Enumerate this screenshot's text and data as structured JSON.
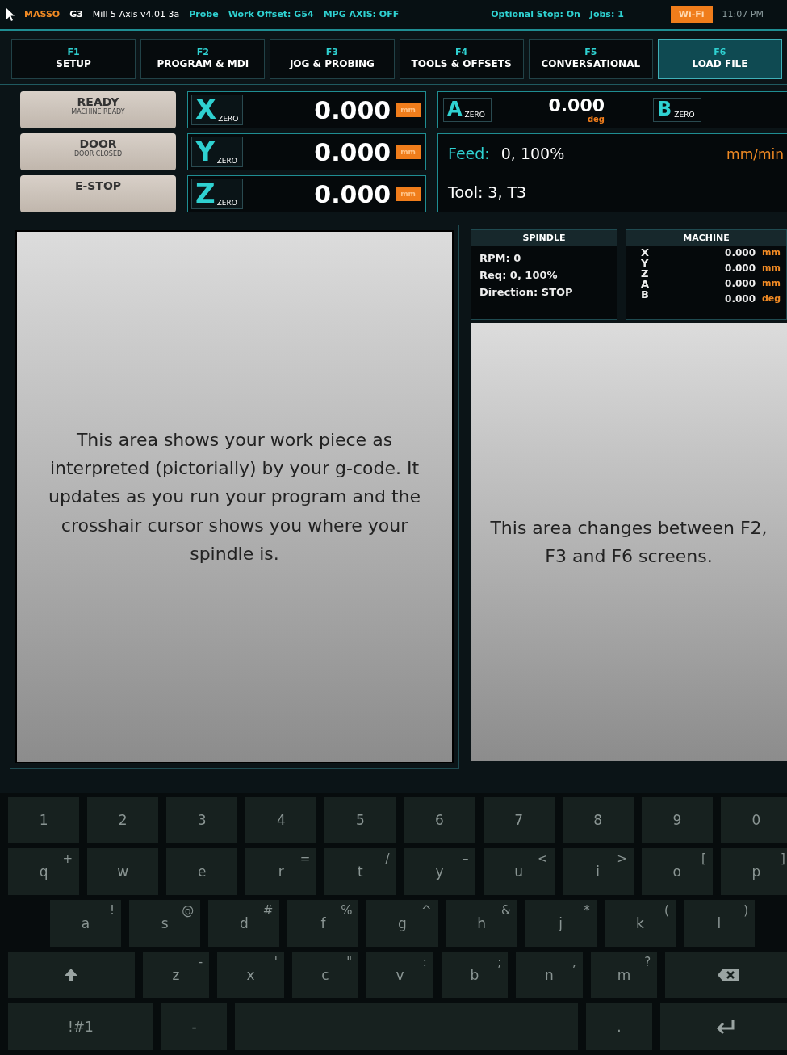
{
  "status_bar": {
    "items": [
      {
        "text": "MASSO",
        "kind": "brand"
      },
      {
        "text": "G3",
        "kind": "model"
      },
      {
        "text": "Mill 5-Axis v4.01 3a",
        "kind": "version"
      },
      {
        "text": "Probe",
        "kind": "info"
      },
      {
        "text": "Work Offset: G54",
        "kind": "info"
      },
      {
        "text": "MPG AXIS: OFF",
        "kind": "info"
      },
      {
        "text": "Optional Stop: On",
        "kind": "info"
      },
      {
        "text": "Jobs: 1",
        "kind": "info"
      }
    ],
    "wifi": "Wi-Fi",
    "time": "11:07 PM"
  },
  "tabs": [
    {
      "key": "F1",
      "label": "SETUP",
      "selected": false
    },
    {
      "key": "F2",
      "label": "PROGRAM & MDI",
      "selected": false
    },
    {
      "key": "F3",
      "label": "JOG & PROBING",
      "selected": false
    },
    {
      "key": "F4",
      "label": "TOOLS & OFFSETS",
      "selected": false
    },
    {
      "key": "F5",
      "label": "CONVERSATIONAL",
      "selected": false
    },
    {
      "key": "F6",
      "label": "LOAD FILE",
      "selected": true
    }
  ],
  "state_buttons": [
    {
      "title": "READY",
      "subtitle": "MACHINE READY"
    },
    {
      "title": "DOOR",
      "subtitle": "DOOR CLOSED"
    },
    {
      "title": "E-STOP"
    }
  ],
  "axes": [
    {
      "axis": "X",
      "zero": "ZERO",
      "value": "0.000",
      "unit": "mm"
    },
    {
      "axis": "Y",
      "zero": "ZERO",
      "value": "0.000",
      "unit": "mm"
    },
    {
      "axis": "Z",
      "zero": "ZERO",
      "value": "0.000",
      "unit": "mm"
    }
  ],
  "rotary": {
    "a_axis": "A",
    "a_zero": "ZERO",
    "value": "0.000",
    "unit": "deg",
    "b_axis": "B",
    "b_zero": "ZERO"
  },
  "feed": {
    "label": "Feed:",
    "value": "0, 100%",
    "unit": "mm/min",
    "tool": "Tool: 3, T3"
  },
  "work_view": {
    "text": "This area shows your work piece as interpreted (pictorially) by your g-code. It updates as you run your program and the crosshair cursor shows you where your spindle is."
  },
  "spindle": {
    "title": "SPINDLE",
    "lines": [
      "RPM: 0",
      "Req: 0, 100%",
      "Direction: STOP"
    ]
  },
  "machine": {
    "title": "MACHINE",
    "axes": [
      "X",
      "Y",
      "Z",
      "A",
      "B"
    ],
    "rows": [
      {
        "value": "0.000",
        "unit": "mm"
      },
      {
        "value": "0.000",
        "unit": "mm"
      },
      {
        "value": "0.000",
        "unit": "mm"
      },
      {
        "value": "0.000",
        "unit": "deg"
      }
    ]
  },
  "side_view": {
    "text": "This area changes between F2, F3 and F6 screens."
  },
  "keyboard": [
    [
      {
        "kind": "char",
        "label": "1"
      },
      {
        "kind": "char",
        "label": "2"
      },
      {
        "kind": "char",
        "label": "3"
      },
      {
        "kind": "char",
        "label": "4"
      },
      {
        "kind": "char",
        "label": "5"
      },
      {
        "kind": "char",
        "label": "6"
      },
      {
        "kind": "char",
        "label": "7"
      },
      {
        "kind": "char",
        "label": "8"
      },
      {
        "kind": "char",
        "label": "9"
      },
      {
        "kind": "char",
        "label": "0"
      }
    ],
    [
      {
        "kind": "char",
        "label": "q",
        "alt": "+"
      },
      {
        "kind": "char",
        "label": "w"
      },
      {
        "kind": "char",
        "label": "e"
      },
      {
        "kind": "char",
        "label": "r",
        "alt": "="
      },
      {
        "kind": "char",
        "label": "t",
        "alt": "/"
      },
      {
        "kind": "char",
        "label": "y",
        "alt": "–"
      },
      {
        "kind": "char",
        "label": "u",
        "alt": "<"
      },
      {
        "kind": "char",
        "label": "i",
        "alt": ">"
      },
      {
        "kind": "char",
        "label": "o",
        "alt": "["
      },
      {
        "kind": "char",
        "label": "p",
        "alt": "]"
      }
    ],
    [
      {
        "kind": "char",
        "label": "a",
        "alt": "!"
      },
      {
        "kind": "char",
        "label": "s",
        "alt": "@"
      },
      {
        "kind": "char",
        "label": "d",
        "alt": "#"
      },
      {
        "kind": "char",
        "label": "f",
        "alt": "%"
      },
      {
        "kind": "char",
        "label": "g",
        "alt": "^"
      },
      {
        "kind": "char",
        "label": "h",
        "alt": "&"
      },
      {
        "kind": "char",
        "label": "j",
        "alt": "*"
      },
      {
        "kind": "char",
        "label": "k",
        "alt": "("
      },
      {
        "kind": "char",
        "label": "l",
        "alt": ")"
      }
    ],
    [
      {
        "kind": "shift"
      },
      {
        "kind": "char",
        "label": "z",
        "alt": "-"
      },
      {
        "kind": "char",
        "label": "x",
        "alt": "'"
      },
      {
        "kind": "char",
        "label": "c",
        "alt": "\""
      },
      {
        "kind": "char",
        "label": "v",
        "alt": ":"
      },
      {
        "kind": "char",
        "label": "b",
        "alt": ";"
      },
      {
        "kind": "char",
        "label": "n",
        "alt": ","
      },
      {
        "kind": "char",
        "label": "m",
        "alt": "?"
      },
      {
        "kind": "backspace"
      }
    ],
    [
      {
        "kind": "mode",
        "label": "!#1"
      },
      {
        "kind": "char",
        "label": "-"
      },
      {
        "kind": "space"
      },
      {
        "kind": "char",
        "label": "."
      },
      {
        "kind": "enter"
      }
    ]
  ]
}
